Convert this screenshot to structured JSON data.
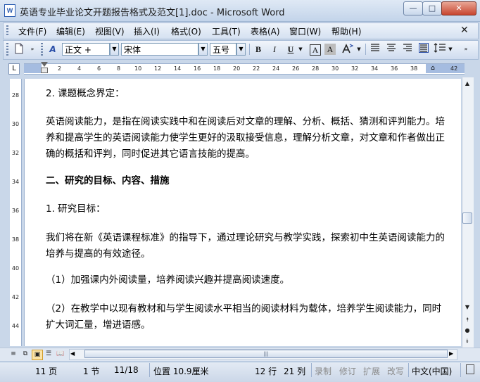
{
  "window": {
    "title": "英语专业毕业论文开题报告格式及范文[1].doc - Microsoft Word",
    "app_icon": "W",
    "controls": {
      "minimize": "—",
      "maximize": "□",
      "close": "✕"
    }
  },
  "menu": {
    "items": [
      "文件(F)",
      "编辑(E)",
      "视图(V)",
      "插入(I)",
      "格式(O)",
      "工具(T)",
      "表格(A)",
      "窗口(W)",
      "帮助(H)"
    ],
    "close_doc": "✕"
  },
  "toolbar": {
    "style_value": "正文 +",
    "font_value": "宋体",
    "size_value": "五号",
    "bold": "B",
    "italic": "I",
    "underline": "U",
    "char_border": "A",
    "char_shading": "A"
  },
  "ruler": {
    "corner": "L",
    "ticks": [
      "2",
      "4",
      "6",
      "8",
      "10",
      "12",
      "14",
      "16",
      "18",
      "20",
      "22",
      "24",
      "26",
      "28",
      "30",
      "32",
      "34",
      "36",
      "38",
      "42"
    ]
  },
  "vruler": {
    "ticks": [
      "28",
      "30",
      "32",
      "34",
      "36",
      "38",
      "40",
      "42",
      "44"
    ]
  },
  "document": {
    "paragraphs": [
      {
        "text": "2. 课题概念界定：",
        "style": "normal"
      },
      {
        "text": "英语阅读能力，是指在阅读实践中和在阅读后对文章的理解、分析、概括、猜测和评判能力。培养和提高学生的英语阅读能力使学生更好的汲取接受信息，理解分析文章，对文章和作者做出正确的概括和评判，同时促进其它语言技能的提高。",
        "style": "normal"
      },
      {
        "text": "二、研究的目标、内容、措施",
        "style": "heading"
      },
      {
        "text": "1. 研究目标：",
        "style": "normal"
      },
      {
        "text": "我们将在新《英语课程标准》的指导下，通过理论研究与教学实践，探索初中生英语阅读能力的培养与提高的有效途径。",
        "style": "normal"
      },
      {
        "text": "（1）加强课内外阅读量，培养阅读兴趣并提高阅读速度。",
        "style": "normal"
      },
      {
        "text": "（2）在教学中以现有教材和与学生阅读水平相当的阅读材料为载体，培养学生阅读能力，同时扩大词汇量，增进语感。",
        "style": "normal"
      }
    ]
  },
  "statusbar": {
    "page": "11 页",
    "section": "1 节",
    "page_count": "11/18",
    "position": "位置 10.9厘米",
    "line": "12 行",
    "column": "21 列",
    "rec": "录制",
    "trk": "修订",
    "ext": "扩展",
    "ovr": "改写",
    "language": "中文(中国)"
  }
}
